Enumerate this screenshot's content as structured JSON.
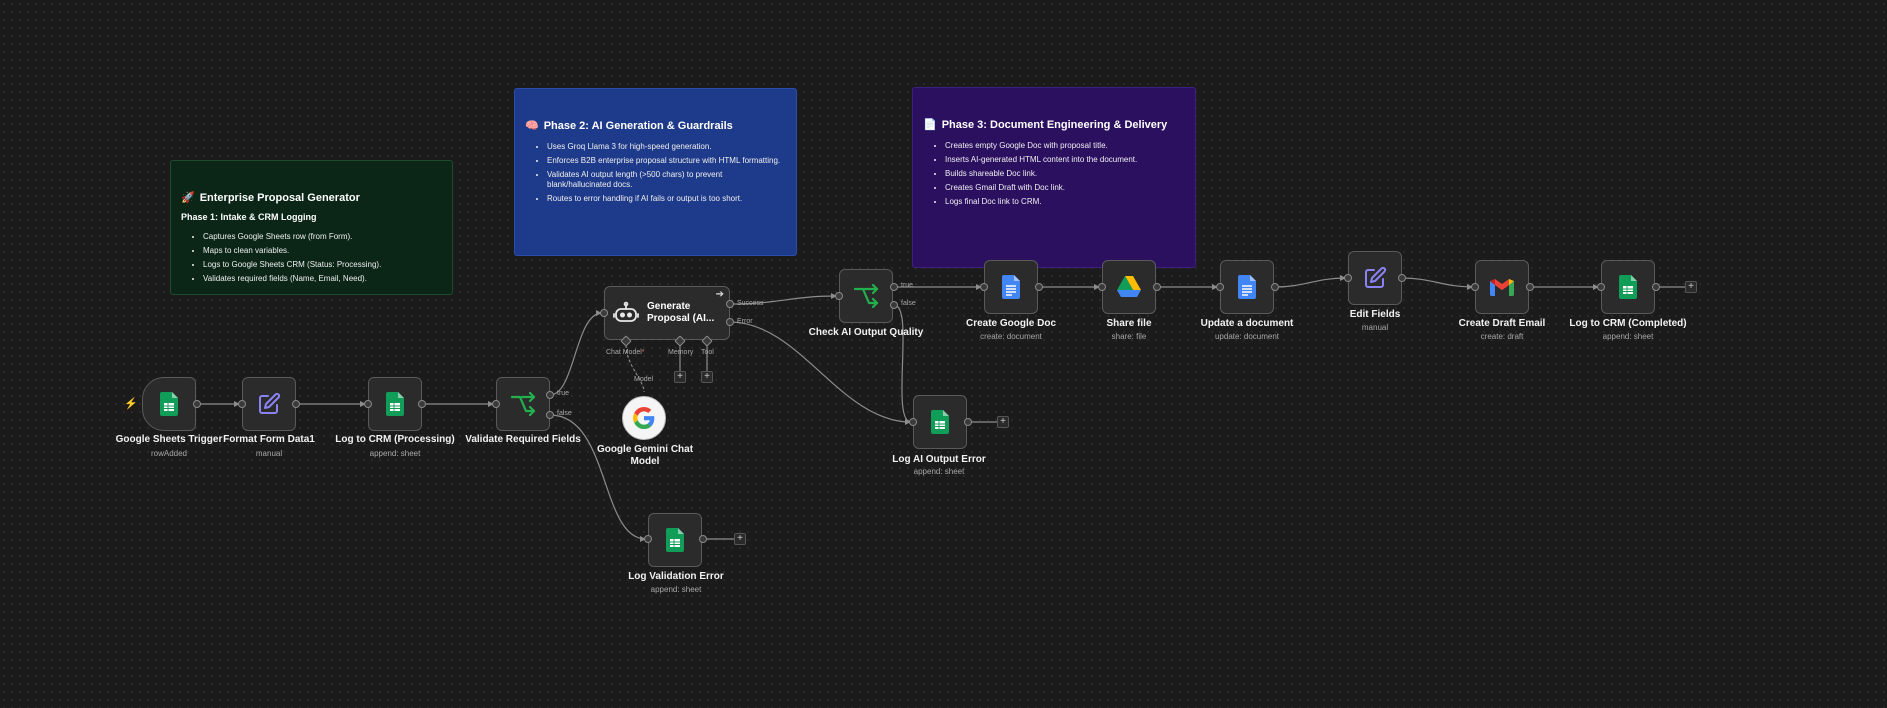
{
  "stickies": {
    "intake": {
      "icon": "🚀",
      "title": "Enterprise Proposal Generator",
      "subtitle": "Phase 1: Intake & CRM Logging",
      "items": [
        "Captures Google Sheets row (from Form).",
        "Maps to clean variables.",
        "Logs to Google Sheets CRM (Status: Processing).",
        "Validates required fields (Name, Email, Need)."
      ]
    },
    "ai": {
      "icon": "🧠",
      "title": "Phase 2: AI Generation & Guardrails",
      "items": [
        "Uses Groq Llama 3 for high-speed generation.",
        "Enforces B2B enterprise proposal structure with HTML formatting.",
        "Validates AI output length (>500 chars) to prevent blank/hallucinated docs.",
        "Routes to error handling if AI fails or output is too short."
      ]
    },
    "delivery": {
      "icon": "📄",
      "title": "Phase 3: Document Engineering & Delivery",
      "items": [
        "Creates empty Google Doc with proposal title.",
        "Inserts AI-generated HTML content into the document.",
        "Builds shareable Doc link.",
        "Creates Gmail Draft with Doc link.",
        "Logs final Doc link to CRM."
      ]
    }
  },
  "nodes": {
    "sheets_trigger": {
      "label": "Google Sheets Trigger",
      "sub": "rowAdded",
      "icon": "google-sheets-icon"
    },
    "format_form": {
      "label": "Format Form Data1",
      "sub": "manual",
      "icon": "pencil-icon"
    },
    "log_crm_processing": {
      "label": "Log to CRM (Processing)",
      "sub": "append: sheet",
      "icon": "google-sheets-icon"
    },
    "validate_fields": {
      "label": "Validate Required Fields",
      "true_label": "true",
      "false_label": "false",
      "icon": "if-branch-icon"
    },
    "generate_proposal": {
      "label": "Generate Proposal (AI...",
      "port_success": "Success",
      "port_error": "Error",
      "port_chat_model": "Chat Model",
      "port_required": "*",
      "port_memory": "Memory",
      "port_tool": "Tool",
      "icon": "robot-icon"
    },
    "gemini_model": {
      "label_line1": "Google Gemini Chat",
      "label_line2": "Model",
      "connector_label": "Model",
      "icon": "google-g-icon"
    },
    "log_validation_error": {
      "label": "Log Validation Error",
      "sub": "append: sheet",
      "icon": "google-sheets-icon"
    },
    "check_ai_quality": {
      "label": "Check AI Output Quality",
      "true_label": "true",
      "false_label": "false",
      "icon": "if-branch-icon"
    },
    "log_ai_error": {
      "label": "Log AI Output Error",
      "sub": "append: sheet",
      "icon": "google-sheets-icon"
    },
    "create_doc": {
      "label": "Create Google Doc",
      "sub": "create: document",
      "icon": "google-docs-icon"
    },
    "share_file": {
      "label": "Share file",
      "sub": "share: file",
      "icon": "google-drive-icon"
    },
    "update_doc": {
      "label": "Update a document",
      "sub": "update: document",
      "icon": "google-docs-icon"
    },
    "edit_fields": {
      "label": "Edit Fields",
      "sub": "manual",
      "icon": "pencil-icon"
    },
    "create_draft": {
      "label": "Create Draft Email",
      "sub": "create: draft",
      "icon": "gmail-icon"
    },
    "log_crm_completed": {
      "label": "Log to CRM (Completed)",
      "sub": "append: sheet",
      "icon": "google-sheets-icon"
    }
  },
  "plus_symbol": "+",
  "colors": {
    "canvas": "#1b1b1b",
    "node_bg": "#2b2b2b",
    "sheets_green": "#0f9d58",
    "docs_blue": "#4285f4",
    "if_green": "#23b14d",
    "pencil_purple": "#8b82f5",
    "trigger_bolt": "#ff6d2d"
  }
}
